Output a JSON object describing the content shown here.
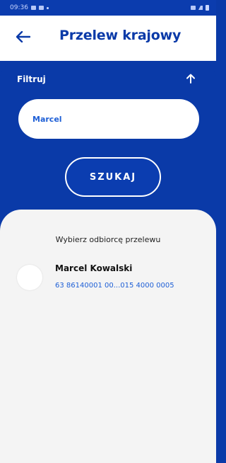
{
  "status_bar": {
    "time": "09:36"
  },
  "header": {
    "title": "Przelew krajowy"
  },
  "filter": {
    "label": "Filtruj",
    "search_value": "Marcel",
    "search_button": "SZUKAJ"
  },
  "results": {
    "heading": "Wybierz odbiorcę przelewu",
    "recipients": [
      {
        "name": "Marcel Kowalski",
        "account": "63 86140001 00...015 4000 0005"
      }
    ]
  },
  "colors": {
    "primary_blue": "#0a3aa8",
    "link_blue": "#1e5fd6",
    "sheet_background": "#f4f4f4"
  }
}
